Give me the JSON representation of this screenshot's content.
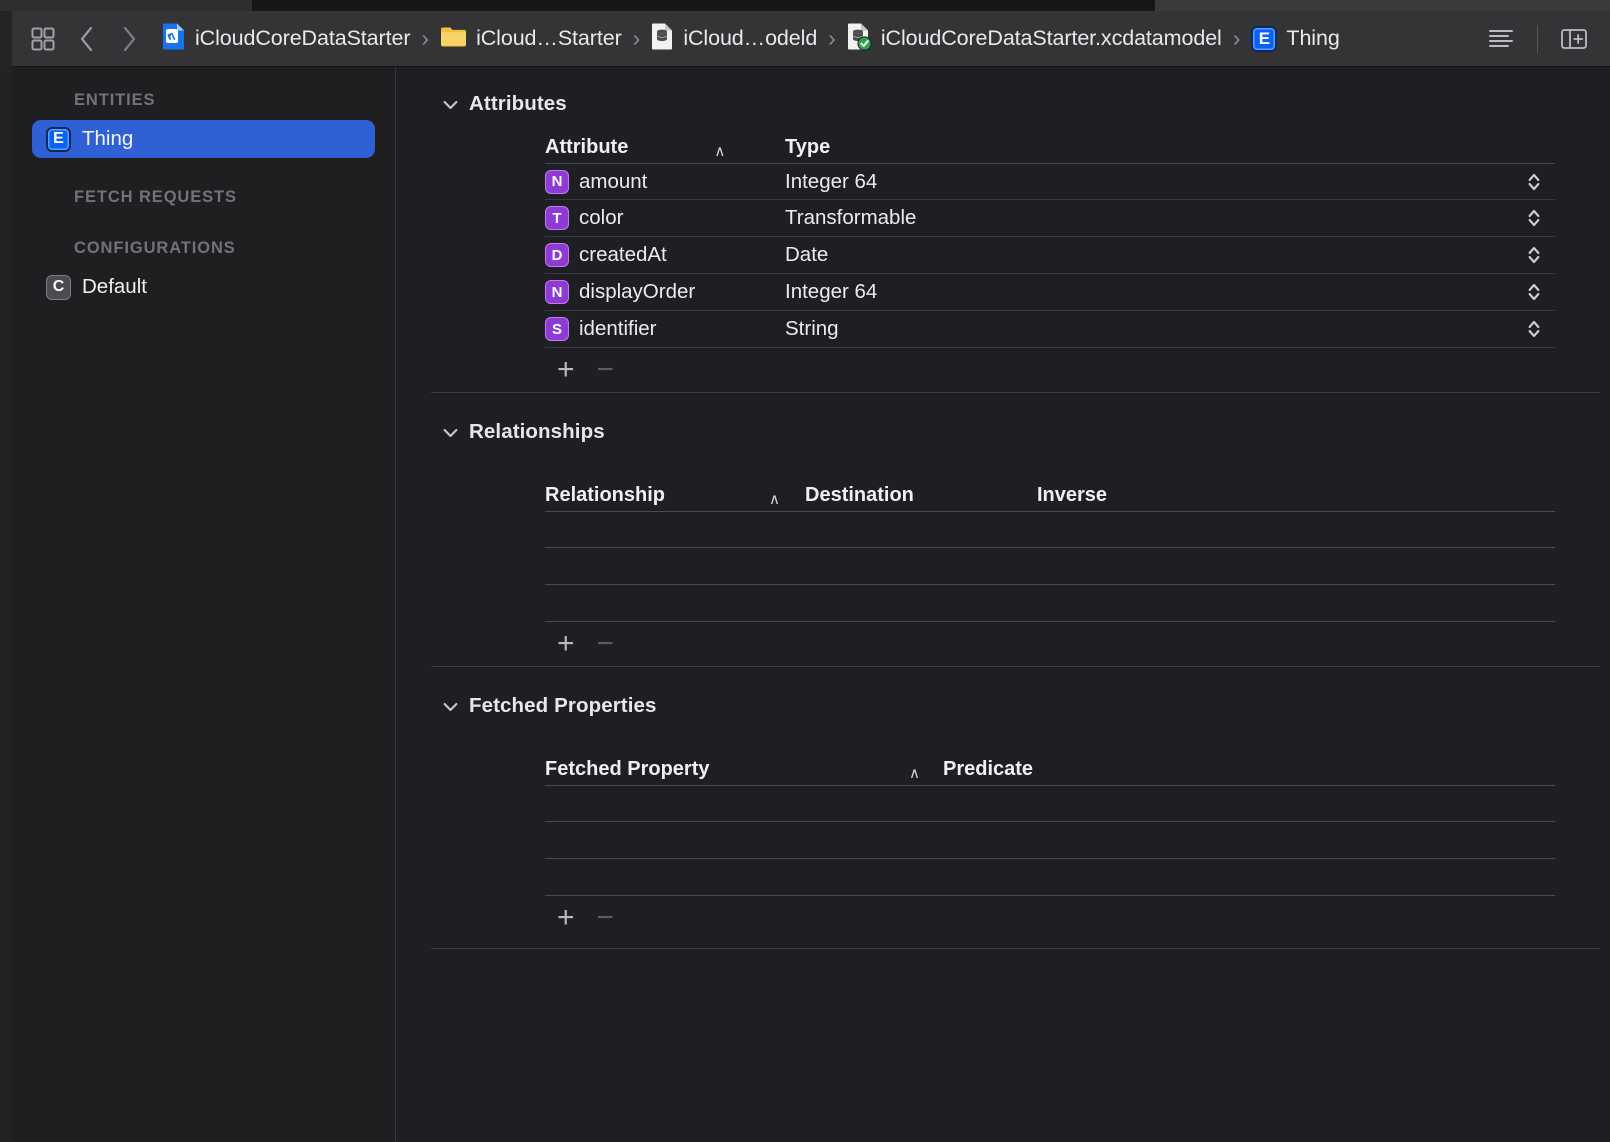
{
  "window": {
    "title": "iCloudCoreDataStarter.xcdatamodel"
  },
  "toolbar": {
    "grid_icon": "grid-squares-icon",
    "back_icon": "chevron-left-icon",
    "forward_icon": "chevron-right-icon",
    "editor_style_icon": "lines-list-icon",
    "inspector_toggle_icon": "right-panel-icon",
    "breadcrumbs": [
      {
        "label": "iCloudCoreDataStarter",
        "icon": "xcode-project-icon"
      },
      {
        "label": "iCloud…Starter",
        "icon": "folder-icon"
      },
      {
        "label": "iCloud…odeld",
        "icon": "datamodel-document-icon"
      },
      {
        "label": "iCloudCoreDataStarter.xcdatamodel",
        "icon": "datamodel-document-checked-icon"
      },
      {
        "label": "Thing",
        "icon": "entity-badge-icon"
      }
    ],
    "separator": "›"
  },
  "sidebar": {
    "groups": [
      {
        "header": "ENTITIES",
        "items": [
          {
            "label": "Thing",
            "badge": "E",
            "badge_kind": "entity",
            "selected": true
          }
        ]
      },
      {
        "header": "FETCH REQUESTS",
        "items": []
      },
      {
        "header": "CONFIGURATIONS",
        "items": [
          {
            "label": "Default",
            "badge": "C",
            "badge_kind": "configuration",
            "selected": false
          }
        ]
      }
    ]
  },
  "editor": {
    "sections": [
      {
        "name": "attributes",
        "title": "Attributes",
        "expanded": true,
        "columns": [
          "Attribute",
          "Type"
        ],
        "sort_column": 0,
        "sort_caret": "∧",
        "rows": [
          {
            "badge": "N",
            "name": "amount",
            "type": "Integer 64"
          },
          {
            "badge": "T",
            "name": "color",
            "type": "Transformable"
          },
          {
            "badge": "D",
            "name": "createdAt",
            "type": "Date"
          },
          {
            "badge": "N",
            "name": "displayOrder",
            "type": "Integer 64"
          },
          {
            "badge": "S",
            "name": "identifier",
            "type": "String"
          }
        ],
        "empty_rows": 0,
        "add_label": "+",
        "remove_label": "−"
      },
      {
        "name": "relationships",
        "title": "Relationships",
        "expanded": true,
        "columns": [
          "Relationship",
          "Destination",
          "Inverse"
        ],
        "sort_column": 0,
        "sort_caret": "∧",
        "rows": [],
        "empty_rows": 3,
        "add_label": "+",
        "remove_label": "−"
      },
      {
        "name": "fetched-properties",
        "title": "Fetched Properties",
        "expanded": true,
        "columns": [
          "Fetched Property",
          "Predicate"
        ],
        "sort_column": 0,
        "sort_caret": "∧",
        "rows": [],
        "empty_rows": 3,
        "add_label": "+",
        "remove_label": "−"
      }
    ]
  },
  "colors": {
    "accent_selection": "#2f61d5",
    "attribute_badge": "#8d3bd4",
    "entity_badge": "#0a62f0",
    "background": "#1f1f23",
    "sidebar_background": "#1f1f22",
    "toolbar_background": "#343437"
  }
}
